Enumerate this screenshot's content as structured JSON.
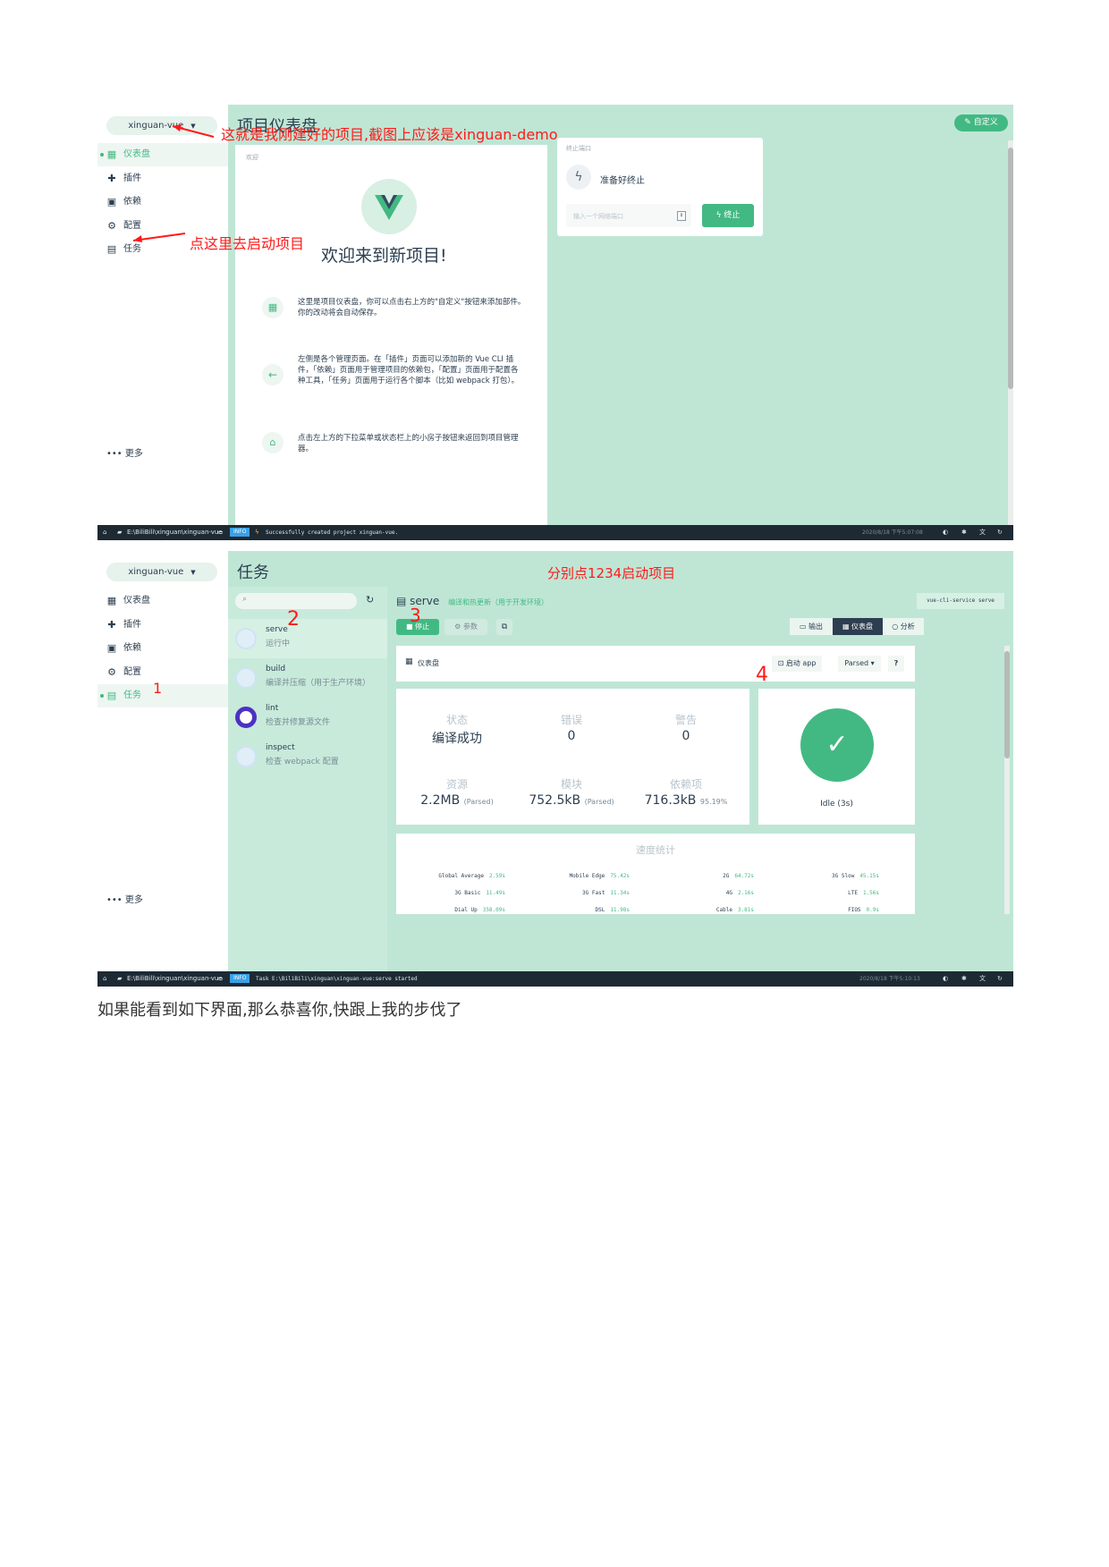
{
  "project_name": "xinguan-vue",
  "nav": {
    "dashboard": "仪表盘",
    "plugins": "插件",
    "dependencies": "依赖",
    "config": "配置",
    "tasks": "任务",
    "more": "更多"
  },
  "shot1": {
    "page_title": "项目仪表盘",
    "customize_label": "自定义",
    "welcome_card": {
      "label": "欢迎",
      "heading": "欢迎来到新项目!",
      "tip1": "这里是项目仪表盘，你可以点击右上方的\"自定义\"按钮来添加部件。你的改动将会自动保存。",
      "tip2": "左侧是各个管理页面。在「插件」页面可以添加新的 Vue CLI 插件，「依赖」页面用于管理项目的依赖包，「配置」页面用于配置各种工具，「任务」页面用于运行各个脚本（比如 webpack 打包）。",
      "tip3": "点击左上方的下拉菜单或状态栏上的小房子按钮来返回到项目管理器。"
    },
    "port_card": {
      "label": "终止端口",
      "status": "准备好终止",
      "input_placeholder": "输入一个网络端口",
      "stop_label": "终止"
    },
    "status_bar": {
      "path": "E:\\BiliBili\\xinguan\\xinguan-vue",
      "badge": "INFO",
      "message": "Successfully created project xinguan-vue.",
      "time": "2020/8/18 下午5:07:08"
    },
    "annotations": {
      "a1": "这就是我刚建好的项目,截图上应该是xinguan-demo",
      "a2": "点这里去启动项目"
    }
  },
  "shot2": {
    "page_title": "任务",
    "annotation_top": "分别点1234启动项目",
    "tasks": [
      {
        "name": "serve",
        "desc": "运行中"
      },
      {
        "name": "build",
        "desc": "编译并压缩（用于生产环境）"
      },
      {
        "name": "lint",
        "desc": "检查并修复源文件"
      },
      {
        "name": "inspect",
        "desc": "检查 webpack 配置"
      }
    ],
    "task_header": {
      "name": "serve",
      "desc": "编译和热更新（用于开发环境）",
      "command": "vue-cli-service serve",
      "stop_label": "停止",
      "params_label": "参数",
      "output_label": "输出",
      "dashboard_label": "仪表盘",
      "analyze_label": "分析"
    },
    "dashboard_bar": {
      "label": "仪表盘",
      "open_app": "启动 app",
      "mode": "Parsed"
    },
    "stats": {
      "status_k": "状态",
      "status_v": "编译成功",
      "errors_k": "错误",
      "errors_v": "0",
      "warnings_k": "警告",
      "warnings_v": "0",
      "assets_k": "资源",
      "assets_v": "2.2MB",
      "assets_s": "(Parsed)",
      "modules_k": "模块",
      "modules_v": "752.5kB",
      "modules_s": "(Parsed)",
      "deps_k": "依赖项",
      "deps_v": "716.3kB",
      "deps_s": "95.19%"
    },
    "idle_label": "Idle (3s)",
    "speed": {
      "title": "速度统计",
      "rows": [
        {
          "k": "Global Average",
          "v": "2.59s"
        },
        {
          "k": "Mobile Edge",
          "v": "75.42s"
        },
        {
          "k": "2G",
          "v": "64.72s"
        },
        {
          "k": "3G Slow",
          "v": "45.15s"
        },
        {
          "k": "3G Basic",
          "v": "11.49s"
        },
        {
          "k": "3G Fast",
          "v": "11.34s"
        },
        {
          "k": "4G",
          "v": "2.16s"
        },
        {
          "k": "LTE",
          "v": "1.56s"
        },
        {
          "k": "Dial Up",
          "v": "358.09s"
        },
        {
          "k": "DSL",
          "v": "11.98s"
        },
        {
          "k": "Cable",
          "v": "3.81s"
        },
        {
          "k": "FIOS",
          "v": "0.9s"
        }
      ]
    },
    "status_bar": {
      "path": "E:\\BiliBili\\xinguan\\xinguan-vue",
      "badge": "INFO",
      "message": "Task E:\\BiliBili\\xinguan\\xinguan-vue:serve started",
      "time": "2020/8/18 下午5:10:13"
    },
    "annotations": {
      "n1": "1",
      "n2": "2",
      "n3": "3",
      "n4": "4"
    }
  },
  "caption": "如果能看到如下界面,那么恭喜你,快跟上我的步伐了",
  "colors": {
    "accent": "#42b983",
    "panel": "#bfe6d5",
    "annotation": "#ff1a1a",
    "statusbar": "#1d2a34"
  }
}
